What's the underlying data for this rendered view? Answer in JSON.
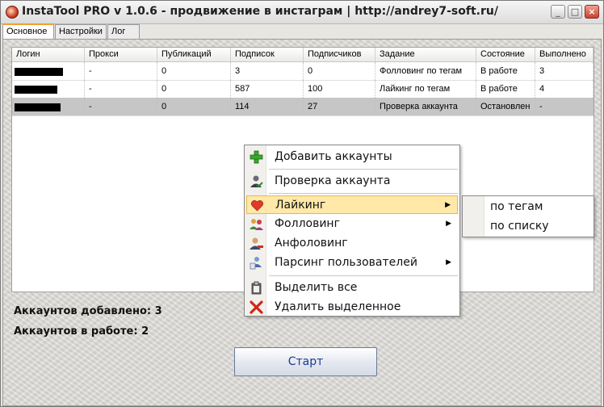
{
  "window": {
    "title": "InstaTool PRO v 1.0.6 - продвижение в инстаграм | http://andrey7-soft.ru/",
    "controls": {
      "minimize": "_",
      "maximize": "□",
      "close": "×"
    }
  },
  "tabs": [
    {
      "label": "Основное"
    },
    {
      "label": "Настройки"
    },
    {
      "label": "Лог"
    }
  ],
  "table": {
    "columns": [
      "Логин",
      "Прокси",
      "Публикаций",
      "Подписок",
      "Подписчиков",
      "Задание",
      "Состояние",
      "Выполнено"
    ],
    "rows": [
      {
        "login": "",
        "proxy": "-",
        "posts": "0",
        "following": "3",
        "followers": "0",
        "task": "Фолловинг по тегам",
        "state": "В работе",
        "done": "3",
        "selected": false
      },
      {
        "login": "",
        "proxy": "-",
        "posts": "0",
        "following": "587",
        "followers": "100",
        "task": "Лайкинг по тегам",
        "state": "В работе",
        "done": "4",
        "selected": false
      },
      {
        "login": "",
        "proxy": "-",
        "posts": "0",
        "following": "114",
        "followers": "27",
        "task": "Проверка аккаунта",
        "state": "Остановлен",
        "done": "-",
        "selected": true
      }
    ]
  },
  "stats": {
    "added": "Аккаунтов добавлено: 3",
    "working": "Аккаунтов в работе: 2"
  },
  "start_button": "Старт",
  "context_menu": {
    "items": [
      {
        "label": "Добавить аккаунты",
        "icon": "plus-icon"
      },
      {
        "label": "Проверка аккаунта",
        "icon": "user-check-icon"
      },
      {
        "label": "Лайкинг",
        "icon": "heart-icon",
        "submenu": true,
        "highlighted": true
      },
      {
        "label": "Фолловинг",
        "icon": "users-icon",
        "submenu": true
      },
      {
        "label": "Анфоловинг",
        "icon": "user-remove-icon"
      },
      {
        "label": "Парсинг пользователей",
        "icon": "user-parse-icon",
        "submenu": true
      },
      {
        "label": "Выделить все",
        "icon": "clipboard-icon"
      },
      {
        "label": "Удалить выделенное",
        "icon": "delete-x-icon"
      }
    ],
    "submenu_arrow": "▶"
  },
  "submenu": {
    "items": [
      "по тегам",
      "по списку"
    ]
  },
  "colors": {
    "highlight": "#ffe8a8",
    "selected_row": "#c6c6c6",
    "start_text": "#1a3a9a"
  }
}
